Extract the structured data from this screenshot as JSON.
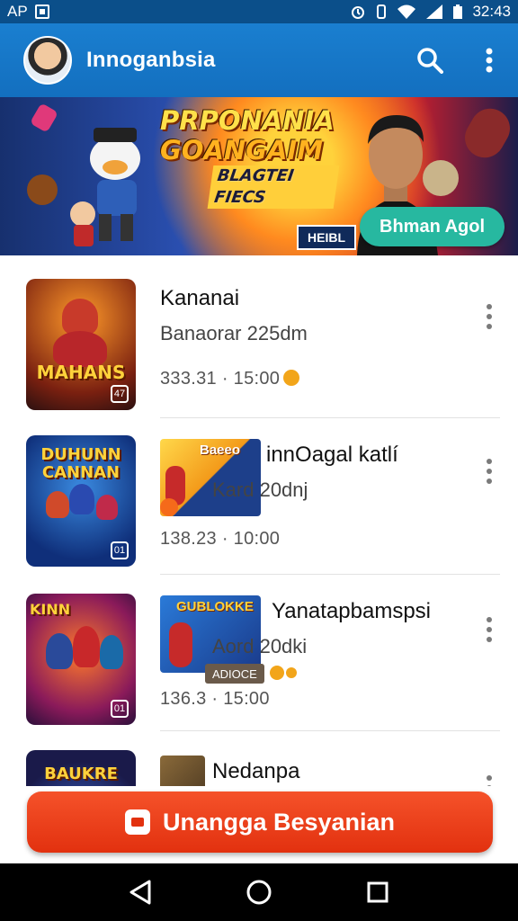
{
  "status_bar": {
    "left_text": "AP",
    "time": "32:43"
  },
  "app_bar": {
    "title": "Innoganbsia"
  },
  "banner": {
    "title_line1": "PRPONANIA",
    "title_line2": "GOANGAIM",
    "title_line3": "BLAGTEI FIECS",
    "button_label": "Bhman Agol",
    "badge_text": "HEIBL"
  },
  "list": {
    "items": [
      {
        "title": "Kananai",
        "subtitle": "Banaorar 225dm",
        "meta": "333.31 · 15:00",
        "thumb_text": "MAHANS",
        "corner": "47"
      },
      {
        "title": "innOagal katlí",
        "subtitle": "Kard 20dnj",
        "meta": "138.23 · 10:00",
        "thumb_text": "DUHUNN CANNAN",
        "mini_text": "Baeeo",
        "corner": "01"
      },
      {
        "title": "Yanatapbamspsi",
        "subtitle": "Aord 20dki",
        "meta": "136.3 · 15:00",
        "thumb_text": "KINN",
        "mini_text": "GUBLOKKE",
        "mini_badge": "ADIOCE",
        "corner": "01"
      },
      {
        "title": "Nedanpa",
        "thumb_text": "BAUKRE"
      }
    ]
  },
  "cta": {
    "label": "Unangga Besyanian"
  },
  "colors": {
    "appbar": "#1a7fd0",
    "cta": "#e2310f",
    "banner_button": "#27b8a0"
  }
}
